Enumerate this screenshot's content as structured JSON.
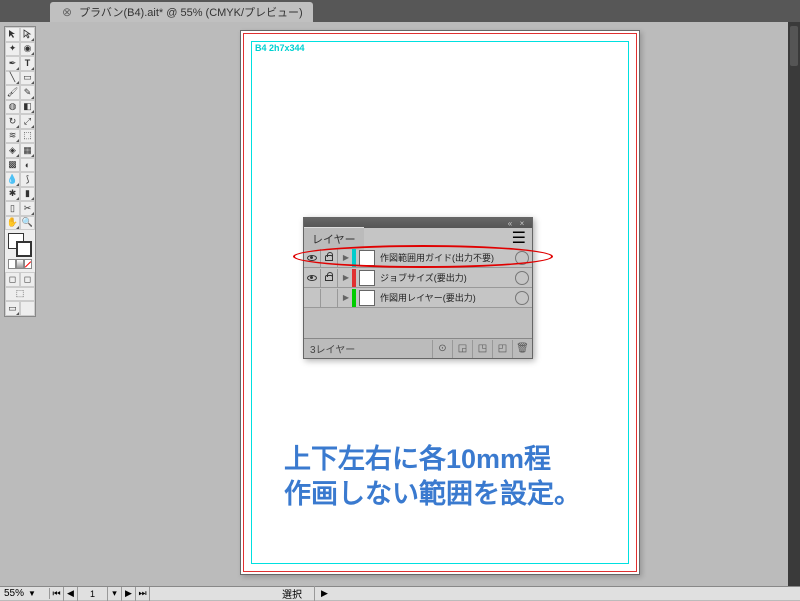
{
  "tab": {
    "title": "プラバン(B4).ait* @ 55% (CMYK/プレビュー)"
  },
  "artboard": {
    "label": "B4  2h7x344"
  },
  "layers_panel": {
    "title": "レイヤー",
    "rows": [
      {
        "name": "作図範囲用ガイド(出力不要)",
        "color": "#00cccc",
        "visible": true,
        "locked": true
      },
      {
        "name": "ジョブサイズ(要出力)",
        "color": "#e03030",
        "visible": true,
        "locked": true
      },
      {
        "name": "作図用レイヤー(要出力)",
        "color": "#00cc00",
        "visible": false,
        "locked": false
      }
    ],
    "footer_label": "3レイヤー"
  },
  "annotation": {
    "line1": "上下左右に各10mm程",
    "line2": "作画しない範囲を設定。"
  },
  "status": {
    "zoom": "55%",
    "page": "1",
    "label": "選択"
  }
}
